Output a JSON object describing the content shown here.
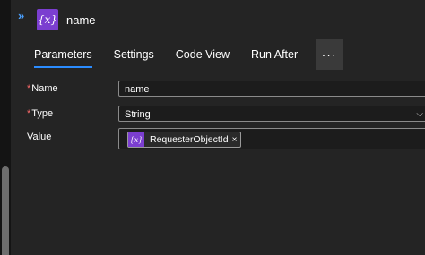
{
  "header": {
    "title": "name",
    "icon_glyph": "{x}",
    "collapse_glyph": "»"
  },
  "tabs": [
    {
      "label": "Parameters",
      "active": true
    },
    {
      "label": "Settings"
    },
    {
      "label": "Code View"
    },
    {
      "label": "Run After"
    },
    {
      "label": "···"
    }
  ],
  "form": {
    "name": {
      "label": "Name",
      "required_mark": "*",
      "value": "name"
    },
    "type": {
      "label": "Type",
      "required_mark": "*",
      "value": "String",
      "chevron": "⌵"
    },
    "value": {
      "label": "Value",
      "token": {
        "icon": "{x}",
        "label": "RequesterObjectId",
        "close": "×"
      }
    }
  },
  "colors": {
    "accent": "#2b8cff",
    "variable_icon": "#7b3ed0",
    "required": "#ff6b6b"
  }
}
